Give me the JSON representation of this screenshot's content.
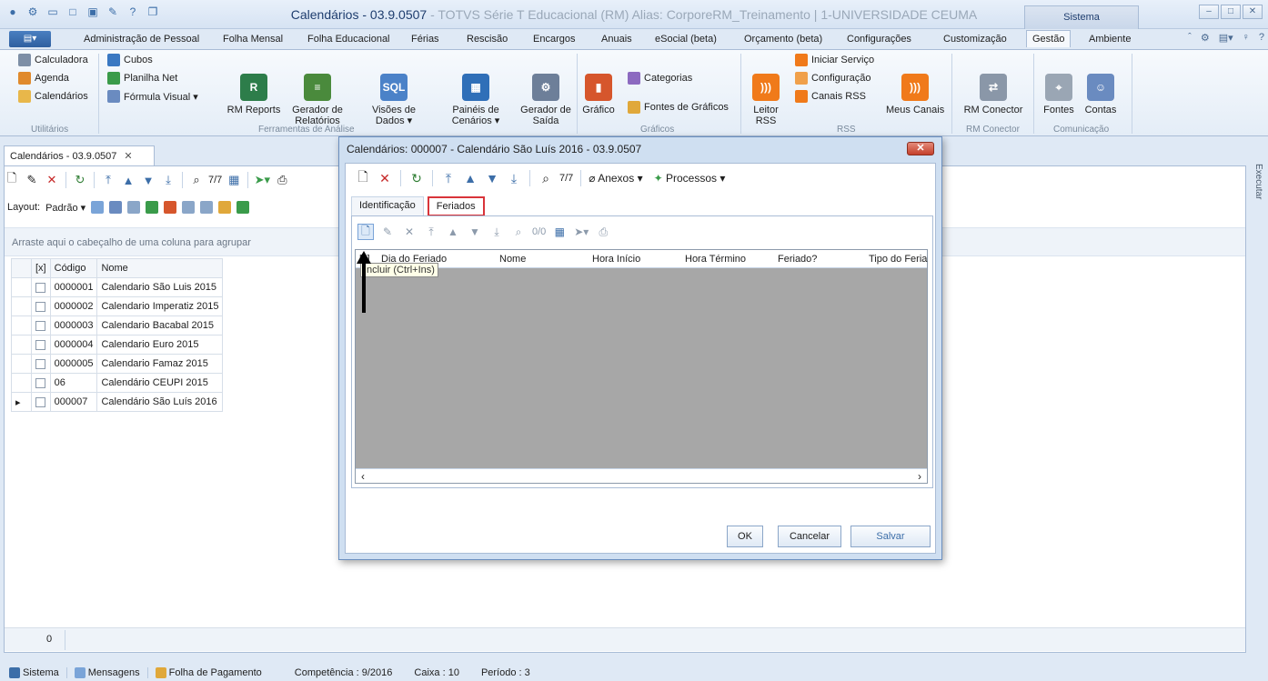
{
  "window": {
    "title_main": "Calendários - 03.9.0507",
    "title_sub": " - TOTVS Série T Educacional (RM) Alias: CorporeRM_Treinamento | 1-UNIVERSIDADE CEUMA",
    "sistema_tab": "Sistema",
    "file_button": "▤▾"
  },
  "ribbon_tabs": [
    "Administração de Pessoal",
    "Folha Mensal",
    "Folha Educacional",
    "Férias",
    "Rescisão",
    "Encargos",
    "Anuais",
    "eSocial (beta)",
    "Orçamento (beta)",
    "Configurações",
    "Customização",
    "Gestão",
    "Ambiente"
  ],
  "ribbon": {
    "utilitarios": {
      "label": "Utilitários",
      "items": [
        "Calculadora",
        "Agenda",
        "Calendários"
      ]
    },
    "cubos": {
      "items": [
        "Cubos",
        "Planilha Net",
        "Fórmula Visual ▾"
      ]
    },
    "ferramentas": {
      "label": "Ferramentas de Análise",
      "rm_reports": "RM Reports",
      "gerador_relatorios": "Gerador de Relatórios",
      "visoes": "Visões de Dados ▾",
      "paineis": "Painéis de Cenários ▾",
      "gerador_saida": "Gerador de Saída"
    },
    "graficos": {
      "label": "Gráficos",
      "grafico": "Gráfico",
      "categorias": "Categorias",
      "fontes_graficos": "Fontes de Gráficos"
    },
    "rss": {
      "label": "RSS",
      "leitor": "Leitor RSS",
      "iniciar": "Iniciar Serviço",
      "configuracao": "Configuração",
      "canais": "Canais RSS",
      "meus_canais": "Meus Canais"
    },
    "rm_conector": {
      "label": "RM Conector",
      "button": "RM Conector"
    },
    "comunicacao": {
      "label": "Comunicação",
      "fontes": "Fontes",
      "contas": "Contas"
    }
  },
  "document_tab": "Calendários - 03.9.0507",
  "toolbar": {
    "nav_count": "7/7",
    "layout_label": "Layout:",
    "layout_value": "Padrão ▾"
  },
  "group_hint": "Arraste aqui o cabeçalho de uma coluna para agrupar",
  "grid": {
    "columns": [
      "[x]",
      "Código",
      "Nome"
    ],
    "rows": [
      {
        "code": "0000001",
        "name": "Calendario São Luis 2015"
      },
      {
        "code": "0000002",
        "name": "Calendario Imperatiz 2015"
      },
      {
        "code": "0000003",
        "name": "Calendario Bacabal 2015"
      },
      {
        "code": "0000004",
        "name": "Calendario Euro 2015"
      },
      {
        "code": "0000005",
        "name": "Calendario Famaz 2015"
      },
      {
        "code": "06",
        "name": "Calendário CEUPI 2015"
      },
      {
        "code": "000007",
        "name": "Calendário São Luís 2016"
      }
    ]
  },
  "footer_count": "0",
  "right_strip": "Executar",
  "status": {
    "sistema": "Sistema",
    "mensagens": "Mensagens",
    "folha": "Folha de Pagamento",
    "competencia": "Competência : 9/2016",
    "caixa": "Caixa : 10",
    "periodo": "Período : 3"
  },
  "dialog": {
    "title": "Calendários: 000007 - Calendário São Luís 2016 - 03.9.0507",
    "nav_count": "7/7",
    "anexos": "Anexos",
    "processos": "Processos",
    "tabs": [
      "Identificação",
      "Feriados"
    ],
    "inner_nav_count": "0/0",
    "columns": [
      "[x]",
      "Dia do Feriado",
      "Nome",
      "Hora Início",
      "Hora Término",
      "Feriado?",
      "Tipo do Feria"
    ],
    "tooltip": "Incluir (Ctrl+Ins)",
    "buttons": {
      "ok": "OK",
      "cancel": "Cancelar",
      "save": "Salvar"
    }
  }
}
